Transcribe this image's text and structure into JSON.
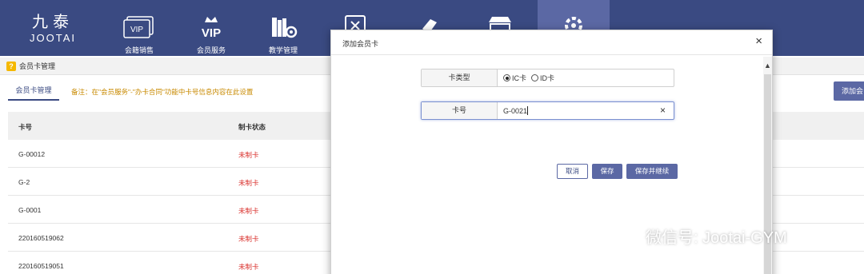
{
  "logo": {
    "cn": "九泰",
    "en": "JOOTAI"
  },
  "nav": [
    {
      "label": "会籍销售",
      "icon": "vip-card-icon"
    },
    {
      "label": "会员服务",
      "icon": "vip-crown-icon"
    },
    {
      "label": "教学管理",
      "icon": "teaching-books-icon"
    },
    {
      "label": "",
      "icon": "calendar-icon"
    },
    {
      "label": "",
      "icon": "product-icon"
    },
    {
      "label": "",
      "icon": "store-icon"
    },
    {
      "label": "",
      "icon": "settings-icon"
    }
  ],
  "breadcrumb": {
    "icon": "?",
    "title": "会员卡管理"
  },
  "subtab": {
    "label": "会员卡管理"
  },
  "note": "备注：在\"会员服务\"-\"办卡合同\"功能中卡号信息内容在此设置",
  "add_button": "添加会",
  "table": {
    "headers": [
      "卡号",
      "制卡状态"
    ],
    "rows": [
      {
        "card_no": "G-00012",
        "status": "未制卡"
      },
      {
        "card_no": "G-2",
        "status": "未制卡"
      },
      {
        "card_no": "G-0001",
        "status": "未制卡"
      },
      {
        "card_no": "220160519062",
        "status": "未制卡"
      },
      {
        "card_no": "220160519051",
        "status": "未制卡"
      }
    ]
  },
  "modal": {
    "title": "添加会员卡",
    "close": "×",
    "card_type_label": "卡类型",
    "card_type_options": [
      "IC卡",
      "ID卡"
    ],
    "card_type_selected": "IC卡",
    "card_no_label": "卡号",
    "card_no_value": "G-0021",
    "clear": "×",
    "buttons": {
      "cancel": "取消",
      "save": "保存",
      "save_next": "保存并继续"
    }
  },
  "watermark": "微信号: Jootai-GYM",
  "colors": {
    "nav_bg": "#3a4a82",
    "accent": "#5b68a4",
    "status_red": "#d9302c"
  }
}
